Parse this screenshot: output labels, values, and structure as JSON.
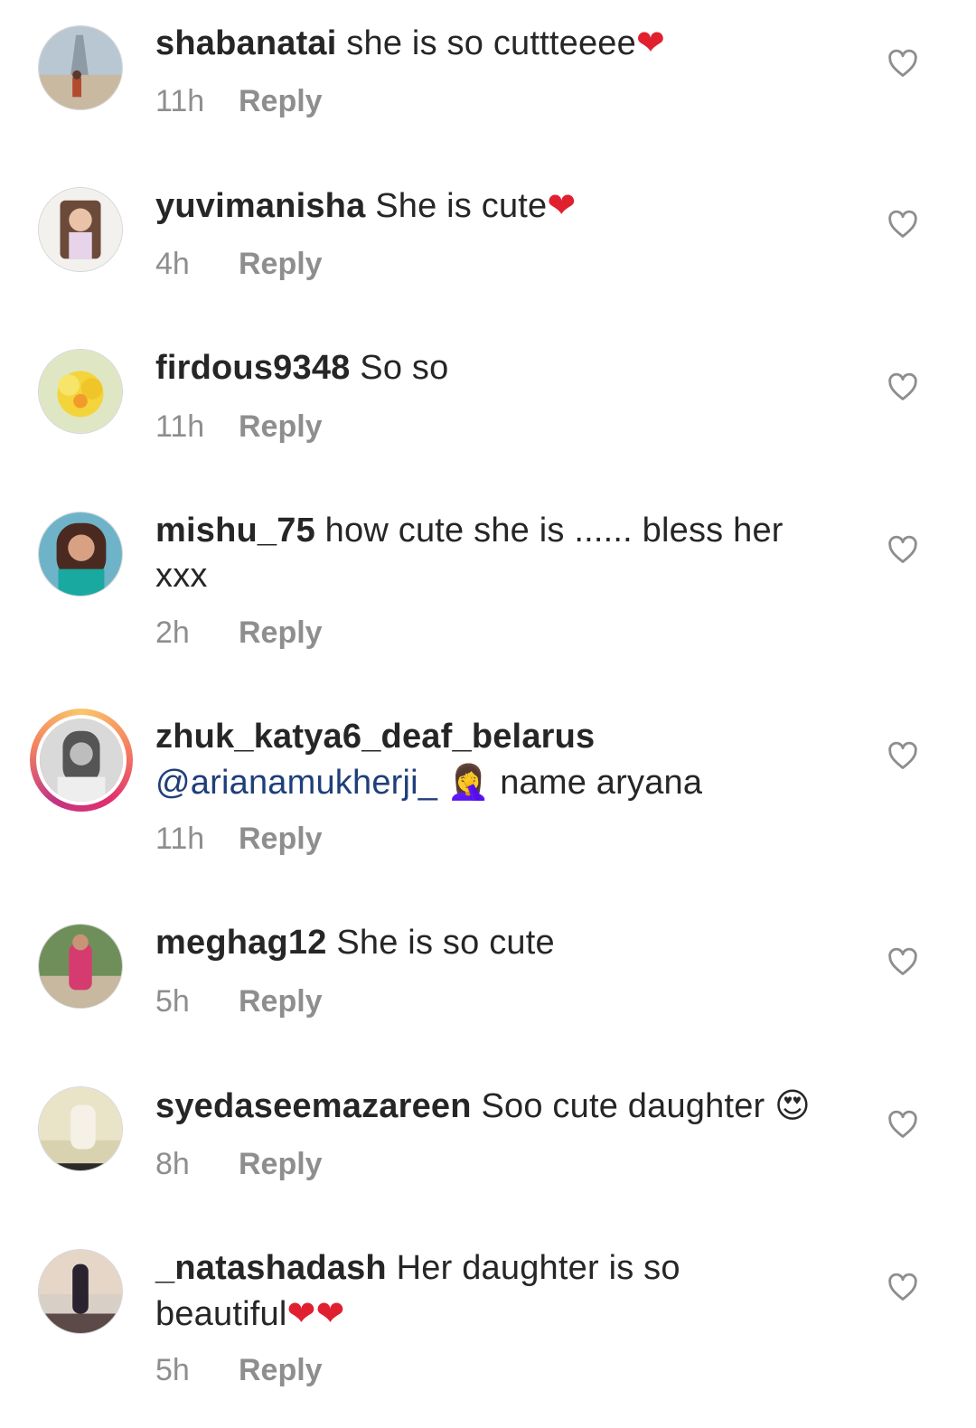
{
  "comments": [
    {
      "username": "shabanatai",
      "text": "she is so cuttteeee",
      "emoji": "❤",
      "time": "11h",
      "reply": "Reply"
    },
    {
      "username": "yuvimanisha",
      "text": "She is cute",
      "emoji": "❤",
      "time": "4h",
      "reply": "Reply"
    },
    {
      "username": "firdous9348",
      "text": "So so",
      "time": "11h",
      "reply": "Reply"
    },
    {
      "username": "mishu_75",
      "text": "how cute she is ...... bless her",
      "text_line2": "xxx",
      "time": "2h",
      "reply": "Reply"
    },
    {
      "username": "zhuk_katya6_deaf_belarus",
      "mention": "@arianamukherji_",
      "emoji": "🤦‍♀️",
      "text": "name aryana",
      "time": "11h",
      "reply": "Reply"
    },
    {
      "username": "meghag12",
      "text": "She is so cute",
      "time": "5h",
      "reply": "Reply"
    },
    {
      "username": "syedaseemazareen",
      "text": "Soo cute daughter",
      "emoji": "😍",
      "time": "8h",
      "reply": "Reply"
    },
    {
      "username": "_natashadash",
      "text": "Her daughter is so",
      "text_line2": "beautiful",
      "emoji": "❤❤",
      "time": "5h",
      "reply": "Reply"
    }
  ],
  "icons": {
    "like": "heart-outline-icon",
    "avatar": "profile-avatar"
  },
  "colors": {
    "reply_gray": "#8e8e8e",
    "mention_blue": "#1f3f7a",
    "heart_red": "#e0202f",
    "story_ring": "#e1306c"
  }
}
